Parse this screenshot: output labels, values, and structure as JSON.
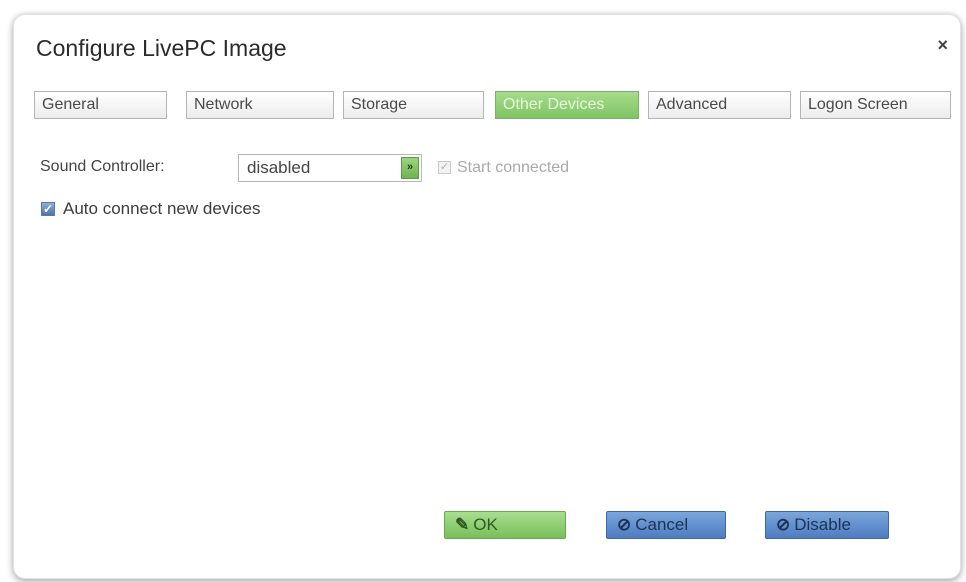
{
  "dialog": {
    "title": "Configure LivePC Image",
    "close_glyph": "×"
  },
  "tabs": [
    {
      "label": "General",
      "active": false
    },
    {
      "label": "Network",
      "active": false
    },
    {
      "label": "Storage",
      "active": false
    },
    {
      "label": "Other Devices",
      "active": true
    },
    {
      "label": "Advanced",
      "active": false
    },
    {
      "label": "Logon Screen",
      "active": false
    }
  ],
  "sound": {
    "label": "Sound Controller:",
    "selected": "disabled",
    "start_connected_label": "Start connected",
    "start_connected_checked": true,
    "start_connected_enabled": false
  },
  "auto_connect": {
    "label": "Auto connect new devices",
    "checked": true
  },
  "buttons": {
    "ok_label": "OK",
    "ok_icon": "pencil-icon",
    "cancel_label": "Cancel",
    "cancel_icon": "no-entry-icon",
    "disable_label": "Disable",
    "disable_icon": "no-entry-icon"
  },
  "colors": {
    "active_tab": "#8fd073",
    "ok_button": "#8fd073",
    "cancel_button": "#5b88c8",
    "checkbox_accent": "#5a7aa6"
  }
}
